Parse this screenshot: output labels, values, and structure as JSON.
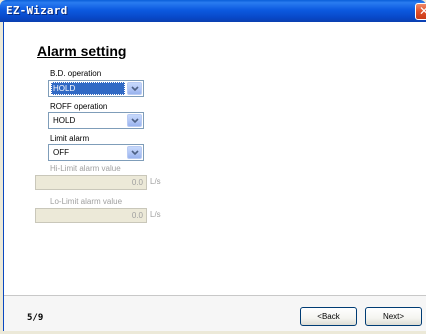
{
  "window": {
    "title": "EZ-Wizard",
    "close_glyph": "✕"
  },
  "page": {
    "heading": "Alarm setting",
    "indicator": "5/9"
  },
  "bd_operation": {
    "label": "B.D. operation",
    "value": "HOLD"
  },
  "roff_operation": {
    "label": "ROFF operation",
    "value": "HOLD"
  },
  "limit_alarm": {
    "label": "Limit alarm",
    "value": "OFF"
  },
  "hi_limit": {
    "label": "Hi-Limit alarm value",
    "value": "0.0",
    "unit": "L/s"
  },
  "lo_limit": {
    "label": "Lo-Limit alarm value",
    "value": "0.0",
    "unit": "L/s"
  },
  "buttons": {
    "back": "<Back",
    "next": "Next>"
  },
  "colors": {
    "titlebar": "#0c5ae0",
    "selection": "#316ac5",
    "disabled_text": "#a0a0a0"
  }
}
